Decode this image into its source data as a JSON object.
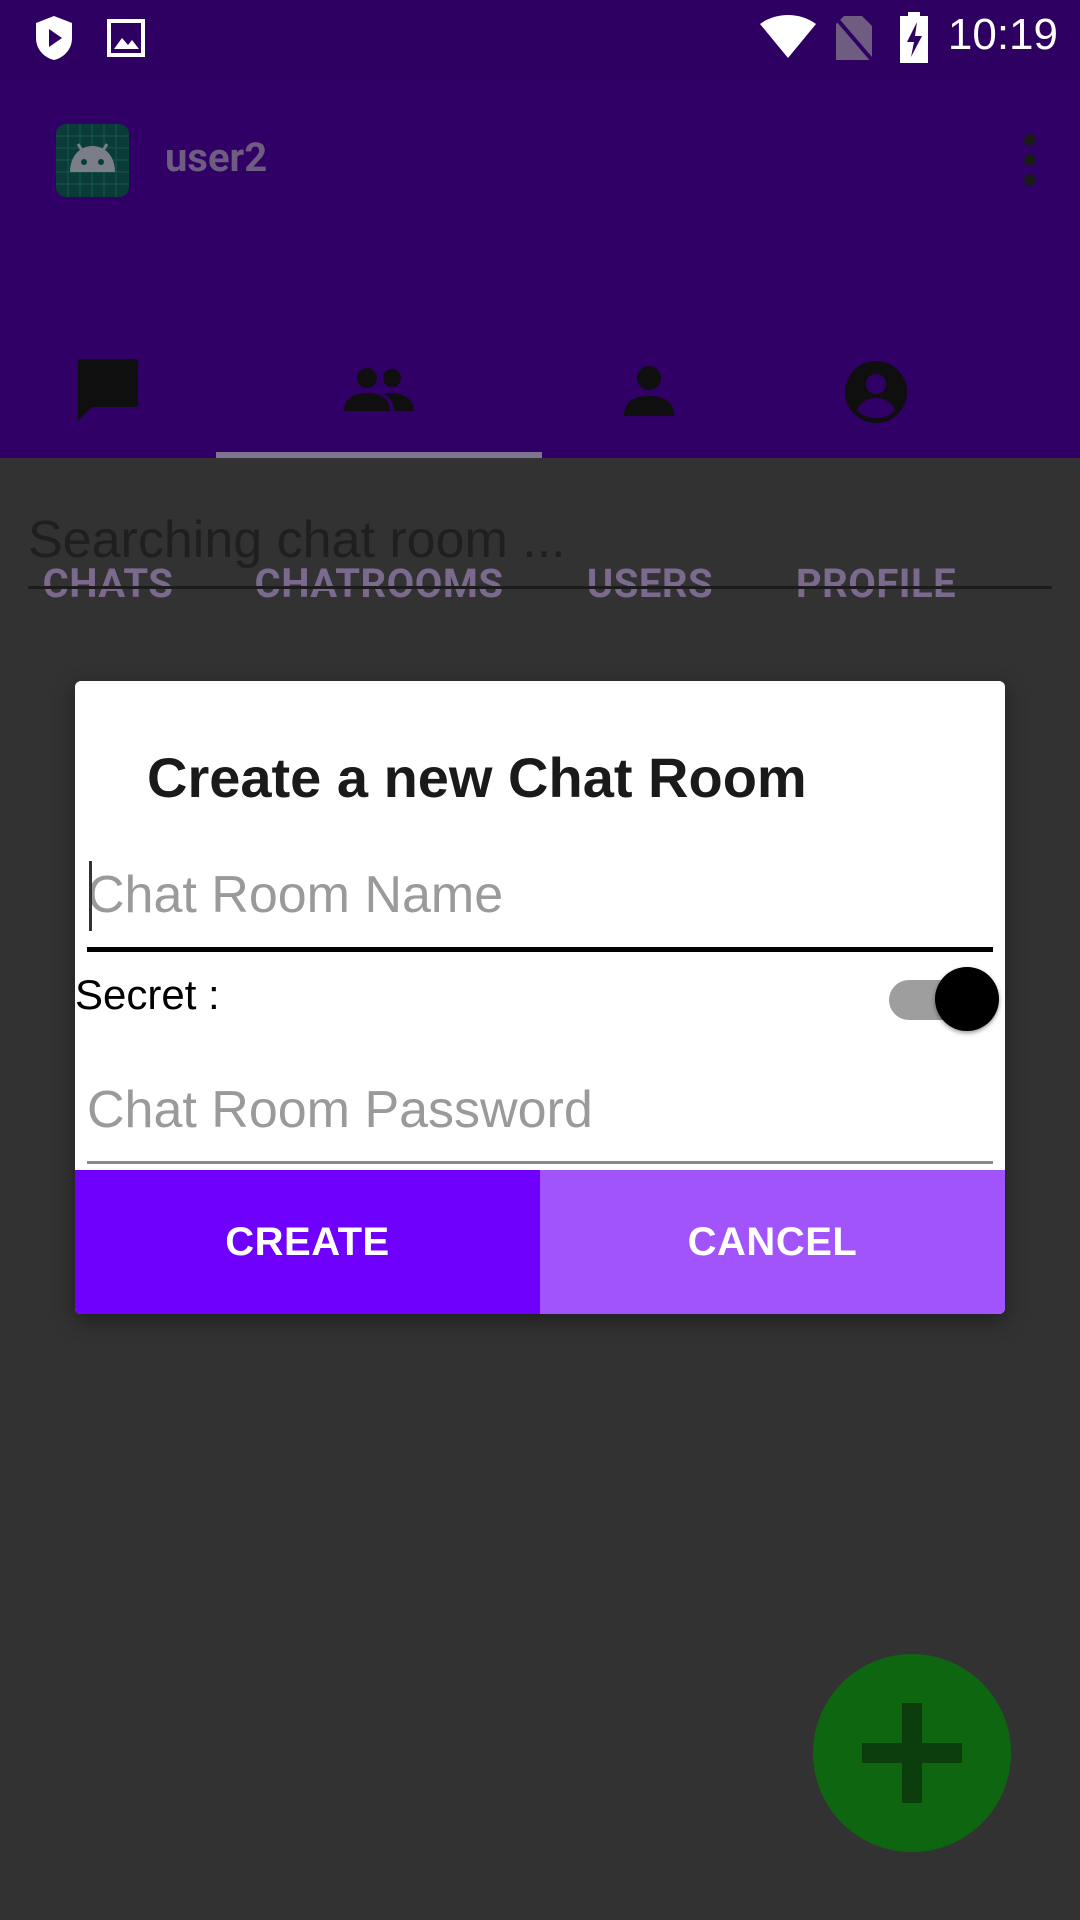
{
  "status_bar": {
    "time": "10:19",
    "left_icons": [
      "shield-play-icon",
      "image-icon"
    ],
    "right_icons": [
      "wifi-icon",
      "no-sim-icon",
      "battery-charging-icon"
    ]
  },
  "app_bar": {
    "title": "user2",
    "app_icon": "android-icon",
    "menu_icon": "more-vert-icon"
  },
  "tabs": [
    {
      "label": "CHATS",
      "icon": "chat-icon",
      "selected": false
    },
    {
      "label": "CHATROOMS",
      "icon": "group-icon",
      "selected": true
    },
    {
      "label": "USERS",
      "icon": "person-icon",
      "selected": false
    },
    {
      "label": "PROFILE",
      "icon": "account-circle-icon",
      "selected": false
    }
  ],
  "search": {
    "placeholder": "Searching chat room ..."
  },
  "dialog": {
    "title": "Create a new Chat Room",
    "name_placeholder": "Chat Room Name",
    "secret_label": "Secret :",
    "secret_on": true,
    "password_placeholder": "Chat Room Password",
    "create_label": "CREATE",
    "cancel_label": "CANCEL"
  },
  "fab": {
    "icon": "plus-icon"
  },
  "colors": {
    "status_bar": "#2e0062",
    "app_bar": "#310067",
    "create_button": "#7000fe",
    "cancel_button": "#a154fb",
    "fab": "#0e6611"
  }
}
